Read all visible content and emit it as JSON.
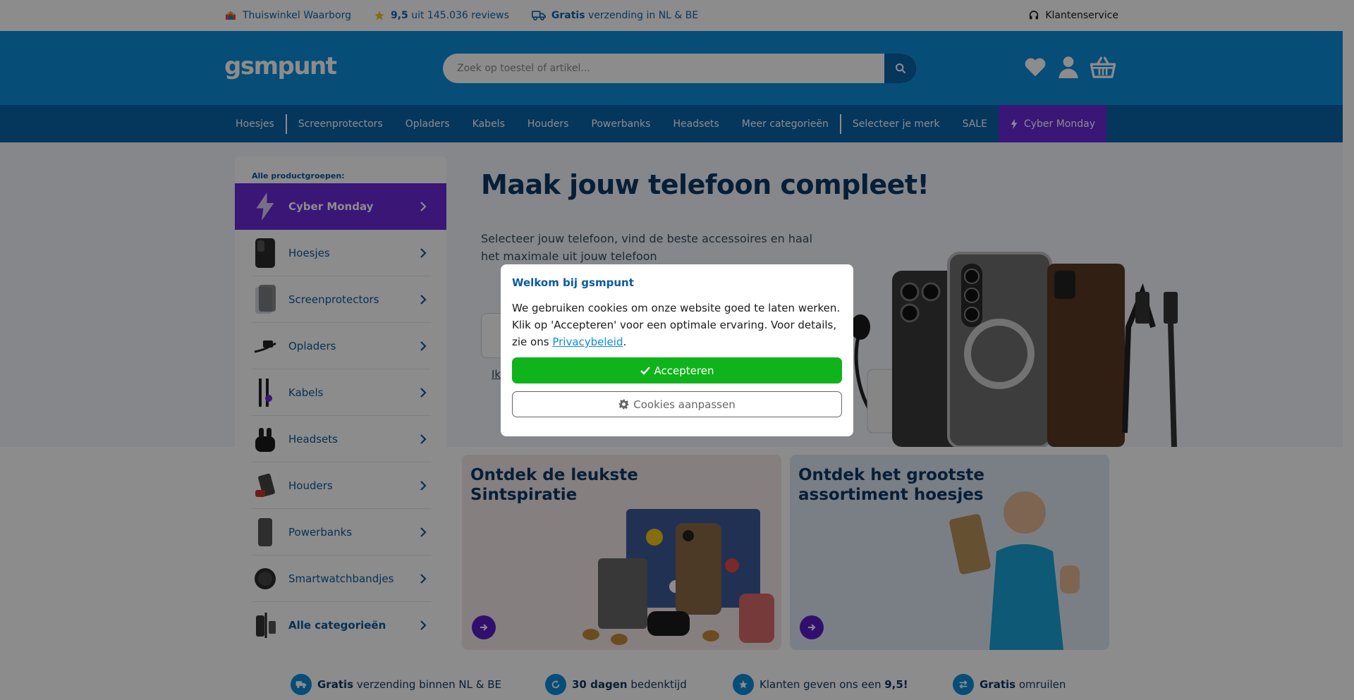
{
  "topbar": {
    "usp1": "Thuiswinkel Waarborg",
    "usp2_score": "9,5",
    "usp2_rest": "uit 145.036 reviews",
    "usp3_bold": "Gratis",
    "usp3_rest": "verzending in NL & BE",
    "service": "Klantenservice"
  },
  "header": {
    "logo": "gsmpunt",
    "search_placeholder": "Zoek op toestel of artikel..."
  },
  "nav": {
    "items": [
      "Hoesjes",
      "Screenprotectors",
      "Opladers",
      "Kabels",
      "Houders",
      "Powerbanks",
      "Headsets",
      "Meer categorieën",
      "Selecteer je merk",
      "SALE"
    ],
    "cyber": "Cyber Monday"
  },
  "sidebar": {
    "heading": "Alle productgroepen:",
    "items": [
      {
        "label": "Cyber Monday"
      },
      {
        "label": "Hoesjes"
      },
      {
        "label": "Screenprotectors"
      },
      {
        "label": "Opladers"
      },
      {
        "label": "Kabels"
      },
      {
        "label": "Headsets"
      },
      {
        "label": "Houders"
      },
      {
        "label": "Powerbanks"
      },
      {
        "label": "Smartwatchbandjes"
      },
      {
        "label": "Alle categorieën"
      }
    ]
  },
  "hero": {
    "title": "Maak jouw telefoon compleet!",
    "subtitle": "Selecteer jouw telefoon, vind de beste accessoires en haal het maximale uit jouw telefoon",
    "link_partial": "Ik"
  },
  "cards": [
    {
      "title": "Ontdek de leukste Sintspiratie"
    },
    {
      "title": "Ontdek het grootste assortiment hoesjes"
    }
  ],
  "bottom_usps": {
    "u1_bold": "Gratis",
    "u1_rest": "verzending binnen NL & BE",
    "u2_bold": "30 dagen",
    "u2_rest": "bedenktijd",
    "u3_rest": "Klanten geven ons een",
    "u3_bold": "9,5!",
    "u4_bold": "Gratis",
    "u4_rest": "omruilen"
  },
  "modal": {
    "title": "Welkom bij gsmpunt",
    "text": "We gebruiken cookies om onze website goed te laten werken. Klik op 'Accepteren' voor een optimale ervaring. Voor details, zie ons",
    "link": "Privacybeleid",
    "text_end": ".",
    "accept": "Accepteren",
    "customize": "Cookies aanpassen"
  },
  "colors": {
    "header_blue": "#0b8cdb",
    "nav_blue": "#0a63a8",
    "cyber_purple": "#6a28d9",
    "accept_green": "#0fb31a"
  },
  "icons": [
    "thuiswinkel-icon",
    "star-icon",
    "truck-icon",
    "headset-icon",
    "search-icon",
    "heart-icon",
    "user-icon",
    "basket-icon",
    "lightning-icon",
    "chevron-right-icon",
    "check-icon",
    "gear-icon",
    "arrow-right-icon"
  ]
}
